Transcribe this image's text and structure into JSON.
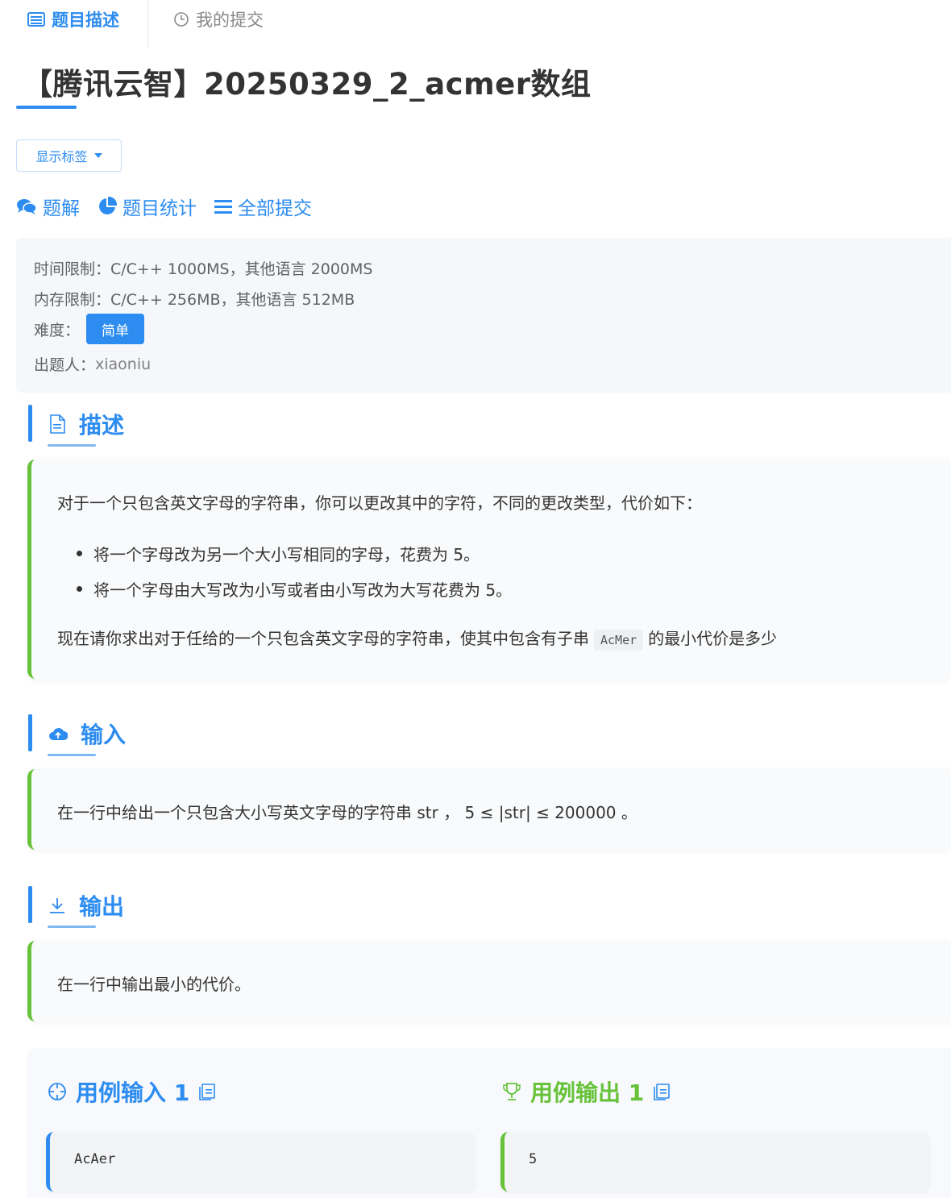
{
  "tabs": {
    "description": "题目描述",
    "my_submissions": "我的提交"
  },
  "title": "【腾讯云智】20250329_2_acmer数组",
  "show_tags": "显示标签",
  "links": {
    "solution": "题解",
    "stats": "题目统计",
    "all_submissions": "全部提交"
  },
  "info": {
    "time_limit": "时间限制：C/C++ 1000MS，其他语言 2000MS",
    "memory_limit": "内存限制：C/C++ 256MB，其他语言 512MB",
    "difficulty_label": "难度：",
    "difficulty": "简单",
    "author_label": "出题人：",
    "author": "xiaoniu"
  },
  "sections": {
    "description": {
      "title": "描述",
      "intro": "对于一个只包含英文字母的字符串，你可以更改其中的字符，不同的更改类型，代价如下：",
      "bullets": [
        "将一个字母改为另一个大小写相同的字母，花费为 5。",
        "将一个字母由大写改为小写或者由小写改为大写花费为 5。"
      ],
      "question_pre": "现在请你求出对于任给的一个只包含英文字母的字符串，使其中包含有子串",
      "question_code": "AcMer",
      "question_post": "的最小代价是多少"
    },
    "input": {
      "title": "输入",
      "text": "在一行中给出一个只包含大小写英文字母的字符串 str ， 5 ≤ |str| ≤ 200000 。"
    },
    "output": {
      "title": "输出",
      "text": "在一行中输出最小的代价。"
    }
  },
  "samples": {
    "input_title": "用例输入 1",
    "output_title": "用例输出 1",
    "input_value": "AcAer",
    "output_value": "5"
  },
  "colors": {
    "accent": "#2d8cf0",
    "green": "#67c23a"
  }
}
